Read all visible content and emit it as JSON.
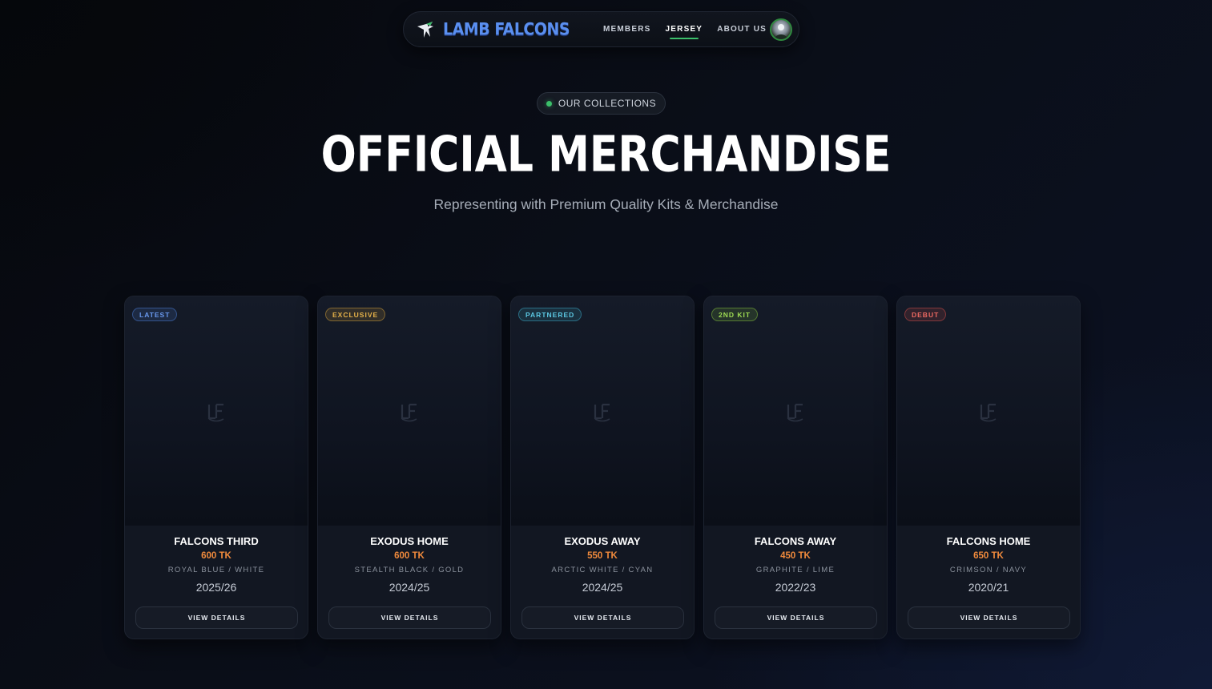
{
  "nav": {
    "brand": "LAMB FALCONS",
    "links": [
      {
        "label": "MEMBERS",
        "active": false
      },
      {
        "label": "JERSEY",
        "active": true
      },
      {
        "label": "ABOUT US",
        "active": false
      }
    ]
  },
  "hero": {
    "pill": "OUR COLLECTIONS",
    "title": "OFFICIAL MERCHANDISE",
    "subtitle": "Representing with Premium Quality Kits & Merchandise"
  },
  "products": [
    {
      "badge": "LATEST",
      "badge_color": "#4f86e6",
      "name": "FALCONS THIRD",
      "price": "600 TK",
      "colors": "ROYAL BLUE / WHITE",
      "season": "2025/26",
      "button": "VIEW DETAILS"
    },
    {
      "badge": "EXCLUSIVE",
      "badge_color": "#e0a93a",
      "name": "EXODUS HOME",
      "price": "600 TK",
      "colors": "STEALTH BLACK / GOLD",
      "season": "2024/25",
      "button": "VIEW DETAILS"
    },
    {
      "badge": "PARTNERED",
      "badge_color": "#3fb8d6",
      "name": "EXODUS AWAY",
      "price": "550 TK",
      "colors": "ARCTIC WHITE / CYAN",
      "season": "2024/25",
      "button": "VIEW DETAILS"
    },
    {
      "badge": "2ND KIT",
      "badge_color": "#8fd13f",
      "name": "FALCONS AWAY",
      "price": "450 TK",
      "colors": "GRAPHITE / LIME",
      "season": "2022/23",
      "button": "VIEW DETAILS"
    },
    {
      "badge": "DEBUT",
      "badge_color": "#e5534b",
      "name": "FALCONS HOME",
      "price": "650 TK",
      "colors": "CRIMSON / NAVY",
      "season": "2020/21",
      "button": "VIEW DETAILS"
    }
  ]
}
